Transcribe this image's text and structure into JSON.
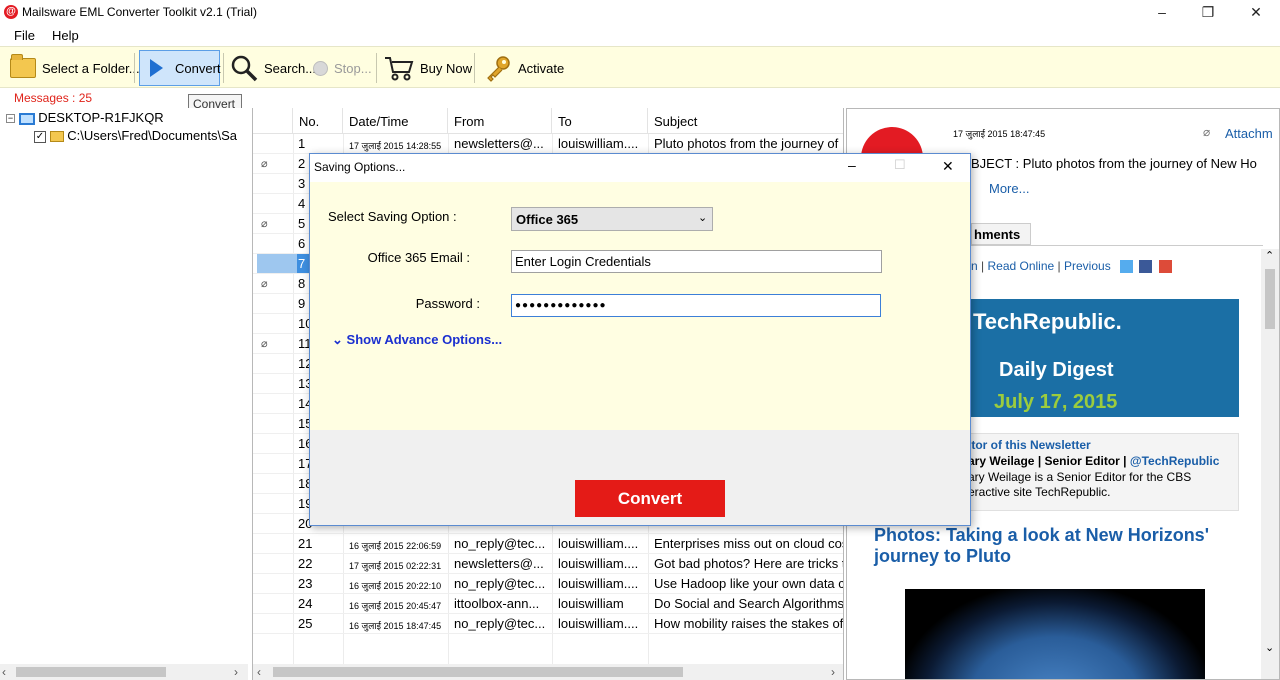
{
  "window": {
    "title": "Mailsware EML Converter Toolkit v2.1 (Trial)",
    "icon": "at-logo-icon"
  },
  "menu": {
    "file": "File",
    "help": "Help"
  },
  "toolbar": {
    "select_folder": "Select a Folder...",
    "convert": "Convert",
    "search": "Search...",
    "stop": "Stop...",
    "buy_now": "Buy Now",
    "activate": "Activate",
    "tooltip": "Convert"
  },
  "messages_count": "Messages : 25",
  "tree": {
    "root": "DESKTOP-R1FJKQR",
    "child": "C:\\Users\\Fred\\Documents\\Sa"
  },
  "grid": {
    "columns": [
      "No.",
      "Date/Time",
      "From",
      "To",
      "Subject"
    ],
    "rows": [
      {
        "no": "1",
        "date": "17 जुलाई 2015 14:28:55",
        "from": "newsletters@...",
        "to": "louiswilliam....",
        "subject": "Pluto photos from the journey of",
        "attach": false
      },
      {
        "no": "2",
        "date": "",
        "from": "",
        "to": "",
        "subject": "",
        "attach": true
      },
      {
        "no": "3",
        "date": "",
        "from": "",
        "to": "",
        "subject": "",
        "attach": false
      },
      {
        "no": "4",
        "date": "",
        "from": "",
        "to": "",
        "subject": "",
        "attach": false
      },
      {
        "no": "5",
        "date": "",
        "from": "",
        "to": "",
        "subject": "",
        "attach": true
      },
      {
        "no": "6",
        "date": "",
        "from": "",
        "to": "",
        "subject": "",
        "attach": false
      },
      {
        "no": "7",
        "date": "",
        "from": "",
        "to": "",
        "subject": "",
        "attach": false
      },
      {
        "no": "8",
        "date": "",
        "from": "",
        "to": "",
        "subject": "",
        "attach": true
      },
      {
        "no": "9",
        "date": "",
        "from": "",
        "to": "",
        "subject": "",
        "attach": false
      },
      {
        "no": "10",
        "date": "",
        "from": "",
        "to": "",
        "subject": "",
        "attach": false
      },
      {
        "no": "11",
        "date": "",
        "from": "",
        "to": "",
        "subject": "",
        "attach": true
      },
      {
        "no": "12",
        "date": "",
        "from": "",
        "to": "",
        "subject": "",
        "attach": false
      },
      {
        "no": "13",
        "date": "",
        "from": "",
        "to": "",
        "subject": "",
        "attach": false
      },
      {
        "no": "14",
        "date": "",
        "from": "",
        "to": "",
        "subject": "",
        "attach": false
      },
      {
        "no": "15",
        "date": "",
        "from": "",
        "to": "",
        "subject": "",
        "attach": false
      },
      {
        "no": "16",
        "date": "",
        "from": "",
        "to": "",
        "subject": "",
        "attach": false
      },
      {
        "no": "17",
        "date": "",
        "from": "",
        "to": "",
        "subject": "",
        "attach": false
      },
      {
        "no": "18",
        "date": "",
        "from": "",
        "to": "",
        "subject": "",
        "attach": false
      },
      {
        "no": "19",
        "date": "",
        "from": "",
        "to": "",
        "subject": "",
        "attach": false
      },
      {
        "no": "20",
        "date": "",
        "from": "",
        "to": "",
        "subject": "",
        "attach": false
      },
      {
        "no": "21",
        "date": "16 जुलाई 2015 22:06:59",
        "from": "no_reply@tec...",
        "to": "louiswilliam....",
        "subject": "Enterprises miss out on cloud cos",
        "attach": false
      },
      {
        "no": "22",
        "date": "17 जुलाई 2015 02:22:31",
        "from": "newsletters@...",
        "to": "louiswilliam....",
        "subject": "Got bad photos? Here are tricks t",
        "attach": false
      },
      {
        "no": "23",
        "date": "16 जुलाई 2015 20:22:10",
        "from": "no_reply@tec...",
        "to": "louiswilliam....",
        "subject": "Use Hadoop like your own data c",
        "attach": false
      },
      {
        "no": "24",
        "date": "16 जुलाई 2015 20:45:47",
        "from": "ittoolbox-ann...",
        "to": "louiswilliam",
        "subject": "Do Social and Search Algorithms",
        "attach": false
      },
      {
        "no": "25",
        "date": "16 जुलाई 2015 18:47:45",
        "from": "no_reply@tec...",
        "to": "louiswilliam....",
        "subject": "How mobility raises the stakes of",
        "attach": false
      }
    ]
  },
  "preview": {
    "date": "17 जुलाई 2015 18:47:45",
    "attachments": "Attachm",
    "subject": "BJECT : Pluto photos from the journey of New Ho",
    "more": "More...",
    "tab": "hments",
    "links": [
      "n",
      "Read Online",
      "Previous"
    ],
    "techrepublic": "TechRepublic.",
    "daily_digest": "Daily Digest",
    "digest_date": "July 17, 2015",
    "bio_heading": "itor of this Newsletter",
    "bio_name": "ary Weilage | Senior Editor | ",
    "bio_handle": "@TechRepublic",
    "bio_text1": "ary Weilage is a Senior Editor for the CBS",
    "bio_text2": "eractive site TechRepublic.",
    "headline": "Photos: Taking a look at New Horizons' journey to Pluto"
  },
  "dialog": {
    "title": "Saving Options...",
    "saving_option_label": "Select Saving Option :",
    "saving_option_value": "Office 365",
    "email_label": "Office 365 Email :",
    "email_value": "Enter Login Credentials",
    "password_label": "Password :",
    "password_value": "●●●●●●●●●●●●●",
    "advance": "Show Advance Options...",
    "convert": "Convert"
  },
  "colors": {
    "accent_red": "#e41b17",
    "toolbar_bg": "#fffee0",
    "link_blue": "#1a5ea8"
  }
}
